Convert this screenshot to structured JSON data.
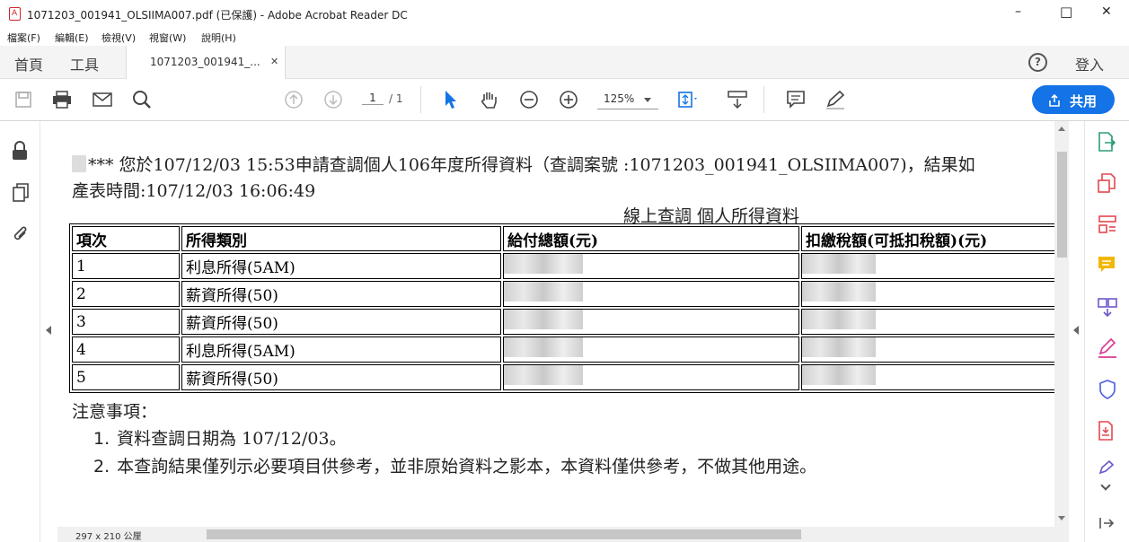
{
  "window": {
    "title": "1071203_001941_OLSIIMA007.pdf (已保護) - Adobe Acrobat Reader DC",
    "controls": {
      "minimize": "–",
      "maximize": "□",
      "close": "✕"
    }
  },
  "menu": [
    "檔案(F)",
    "編輯(E)",
    "檢視(V)",
    "視窗(W)",
    "說明(H)"
  ],
  "tabs": {
    "home": "首頁",
    "tools": "工具",
    "doc_tab": "1071203_001941_...",
    "close": "✕",
    "signin": "登入",
    "help": "?"
  },
  "toolbar": {
    "page_current": "1",
    "page_total": "/ 1",
    "zoom": "125%",
    "share": "共用"
  },
  "document": {
    "line1": "*** 您於107/12/03 15:53申請查調個人106年度所得資料（查調案號 :1071203_001941_OLSIIMA007)，結果如",
    "line2": "產表時間:107/12/03 16:06:49",
    "table_title": "線上查調 個人所得資料",
    "headers": [
      "項次",
      "所得類別",
      "給付總額(元)",
      "扣繳稅額(可抵扣稅額)(元)"
    ],
    "rows": [
      {
        "no": "1",
        "type": "利息所得(5AM)"
      },
      {
        "no": "2",
        "type": "薪資所得(50)"
      },
      {
        "no": "3",
        "type": "薪資所得(50)"
      },
      {
        "no": "4",
        "type": "利息所得(5AM)"
      },
      {
        "no": "5",
        "type": "薪資所得(50)"
      }
    ],
    "notes_title": "注意事項：",
    "notes": [
      {
        "num": "1.",
        "text": "資料查調日期為 107/12/03。"
      },
      {
        "num": "2.",
        "text": "本查詢結果僅列示必要項目供參考，並非原始資料之影本，本資料僅供參考，不做其他用途。"
      }
    ]
  },
  "status": {
    "page_size": "297 x 210 公厘"
  }
}
